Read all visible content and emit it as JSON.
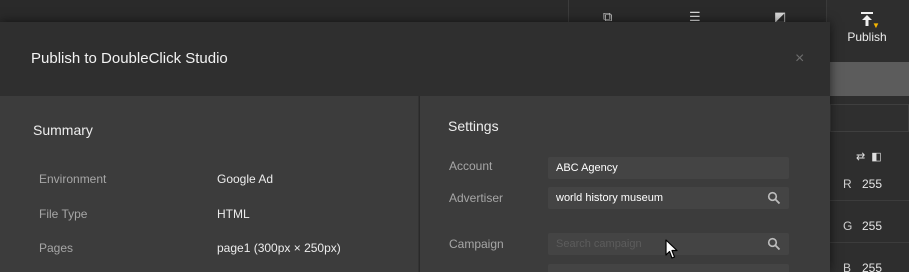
{
  "background": {
    "publish_label": "Publish",
    "color_channels": [
      {
        "channel": "R",
        "value": "255"
      },
      {
        "channel": "G",
        "value": "255"
      },
      {
        "channel": "B",
        "value": "255"
      }
    ]
  },
  "dialog": {
    "title": "Publish to DoubleClick Studio",
    "close_glyph": "×",
    "summary": {
      "title": "Summary",
      "rows": [
        {
          "label": "Environment",
          "value": "Google Ad"
        },
        {
          "label": "File Type",
          "value": "HTML"
        },
        {
          "label": "Pages",
          "value": "page1 (300px × 250px)"
        }
      ]
    },
    "settings": {
      "title": "Settings",
      "account": {
        "label": "Account",
        "value": "ABC Agency"
      },
      "advertiser": {
        "label": "Advertiser",
        "value": "world history museum"
      },
      "campaign": {
        "label": "Campaign",
        "value": "",
        "placeholder": "Search campaign"
      }
    }
  },
  "colors": {
    "accent": "#f4b400",
    "dialog_bg": "#333333",
    "panel_bg": "#3c3c3c"
  }
}
